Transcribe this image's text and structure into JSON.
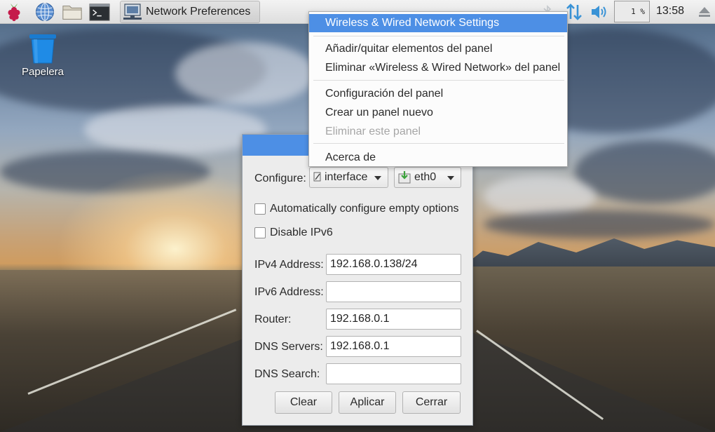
{
  "taskbar": {
    "launchers": [
      {
        "name": "raspberry-menu",
        "icon": "raspberry-icon"
      },
      {
        "name": "web-browser",
        "icon": "globe-icon"
      },
      {
        "name": "file-manager",
        "icon": "folder-icon"
      },
      {
        "name": "terminal",
        "icon": "terminal-icon"
      }
    ],
    "task": {
      "label": "Network Preferences",
      "icon": "network-monitor-icon"
    },
    "tray": {
      "bluetooth_icon": "bluetooth-icon",
      "network_icon": "network-arrows-icon",
      "volume_icon": "volume-icon",
      "cpu_usage": "1 %",
      "clock": "13:58",
      "eject_icon": "eject-icon"
    }
  },
  "desktop": {
    "trash_label": "Papelera"
  },
  "dialog": {
    "configure_label": "Configure:",
    "configure_type": "interface",
    "configure_device": "eth0",
    "auto_configure_label": "Automatically configure empty options",
    "auto_configure_checked": false,
    "disable_ipv6_label": "Disable IPv6",
    "disable_ipv6_checked": false,
    "fields": {
      "ipv4_label": "IPv4 Address:",
      "ipv4_value": "192.168.0.138/24",
      "ipv6_label": "IPv6 Address:",
      "ipv6_value": "",
      "router_label": "Router:",
      "router_value": "192.168.0.1",
      "dns_servers_label": "DNS Servers:",
      "dns_servers_value": "192.168.0.1",
      "dns_search_label": "DNS Search:",
      "dns_search_value": ""
    },
    "buttons": {
      "clear": "Clear",
      "apply": "Aplicar",
      "close": "Cerrar"
    }
  },
  "context_menu": {
    "items": [
      {
        "label": "Wireless & Wired Network Settings",
        "state": "highlighted"
      },
      {
        "label": "Añadir/quitar elementos del panel",
        "state": "normal"
      },
      {
        "label": "Eliminar «Wireless & Wired Network» del panel",
        "state": "normal"
      },
      {
        "label": "Configuración del panel",
        "state": "normal"
      },
      {
        "label": "Crear un panel nuevo",
        "state": "normal"
      },
      {
        "label": "Eliminar este panel",
        "state": "disabled"
      },
      {
        "label": "Acerca de",
        "state": "normal"
      }
    ]
  },
  "colors": {
    "accent": "#4d8fe5",
    "panel_bg": "#e8e8e8",
    "dialog_bg": "#ececec"
  }
}
